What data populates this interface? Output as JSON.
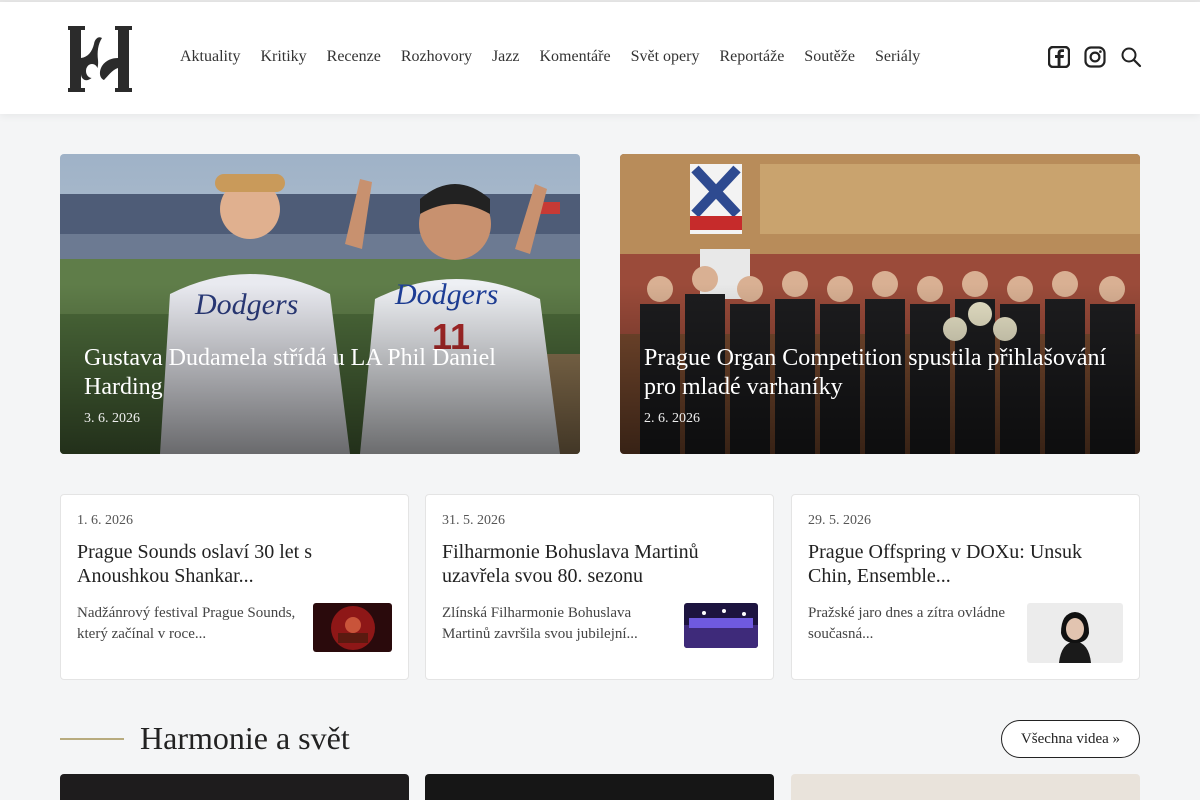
{
  "nav": {
    "items": [
      "Aktuality",
      "Kritiky",
      "Recenze",
      "Rozhovory",
      "Jazz",
      "Komentáře",
      "Svět opery",
      "Reportáže",
      "Soutěže",
      "Seriály"
    ]
  },
  "header_icons": [
    "facebook-icon",
    "instagram-icon",
    "search-icon"
  ],
  "hero": [
    {
      "title": "Gustava Dudamela střídá u LA Phil Daniel Harding",
      "date": "3. 6. 2026"
    },
    {
      "title": "Prague Organ Competition spustila přihlašování pro mladé varhaníky",
      "date": "2. 6. 2026"
    }
  ],
  "cards": [
    {
      "date": "1. 6. 2026",
      "title": "Prague Sounds oslaví 30 let s Anoushkou Shankar...",
      "excerpt": "Nadžánrový festival Prague Sounds, který začínal v roce..."
    },
    {
      "date": "31. 5. 2026",
      "title": "Filharmonie Bohuslava Martinů uzavřela svou 80. sezonu",
      "excerpt": "Zlínská Filharmonie Bohuslava Martinů završila svou jubilejní..."
    },
    {
      "date": "29. 5. 2026",
      "title": "Prague Offspring v DOXu: Unsuk Chin, Ensemble...",
      "excerpt": "Pražské jaro dnes a zítra ovládne současná..."
    }
  ],
  "section": {
    "title": "Harmonie a svět",
    "button": "Všechna videa »"
  },
  "colors": {
    "accent_line": "#b8ab7e",
    "text": "#222222",
    "background": "#f4f5f6"
  }
}
